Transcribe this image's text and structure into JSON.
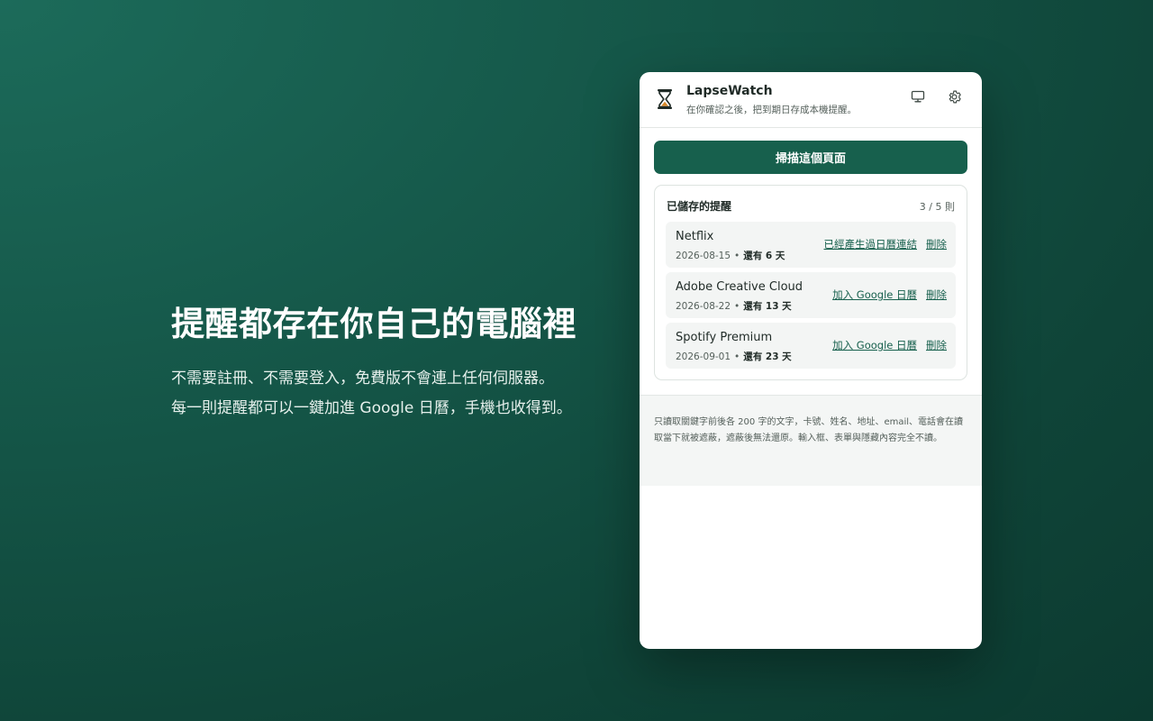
{
  "hero": {
    "title": "提醒都存在你自己的電腦裡",
    "line1": "不需要註冊、不需要登入，免費版不會連上任何伺服器。",
    "line2": "每一則提醒都可以一鍵加進 Google 日曆，手機也收得到。"
  },
  "popup": {
    "app_name": "LapseWatch",
    "tagline": "在你確認之後，把到期日存成本機提醒。",
    "icons": {
      "logo": "hourglass-icon",
      "display": "monitor-icon",
      "settings": "gear-icon"
    },
    "scan_button": "掃描這個頁面",
    "saved": {
      "title": "已儲存的提醒",
      "count": "3 / 5 則",
      "items": [
        {
          "name": "Netflix",
          "date": "2026-08-15",
          "separator": "•",
          "remaining": "還有 6 天",
          "action": "已經產生過日曆連結",
          "delete": "刪除"
        },
        {
          "name": "Adobe Creative Cloud",
          "date": "2026-08-22",
          "separator": "•",
          "remaining": "還有 13 天",
          "action": "加入 Google 日曆",
          "delete": "刪除"
        },
        {
          "name": "Spotify Premium",
          "date": "2026-09-01",
          "separator": "•",
          "remaining": "還有 23 天",
          "action": "加入 Google 日曆",
          "delete": "刪除"
        }
      ]
    },
    "footer_note": "只讀取關鍵字前後各 200 字的文字，卡號、姓名、地址、email、電話會在讀取當下就被遮蔽，遮蔽後無法還原。輸入框、表單與隱藏內容完全不讀。"
  },
  "colors": {
    "brand": "#17604d",
    "background": "#145446",
    "card": "#ffffff"
  }
}
